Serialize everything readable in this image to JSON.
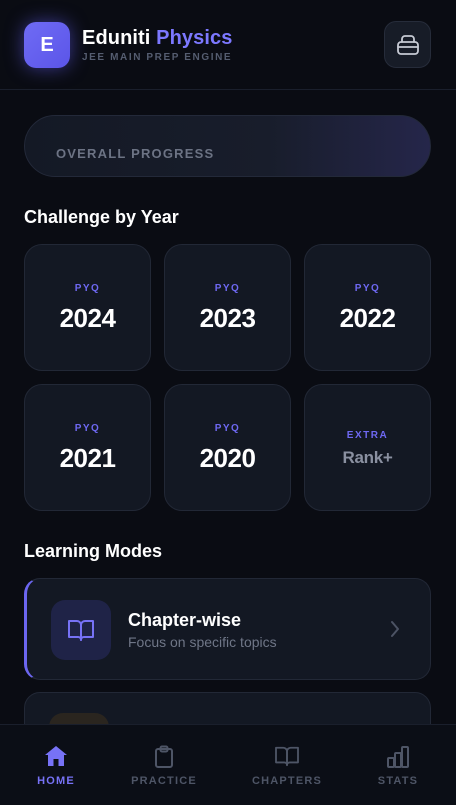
{
  "header": {
    "logo_letter": "E",
    "title_main": "Eduniti",
    "title_accent": "Physics",
    "subtitle": "JEE MAIN PREP ENGINE",
    "profile_icon": "briefcase-icon"
  },
  "progress": {
    "label": "OVERALL PROGRESS"
  },
  "years_section": {
    "title": "Challenge by Year",
    "cards": [
      {
        "tag": "PYQ",
        "value": "2024"
      },
      {
        "tag": "PYQ",
        "value": "2023"
      },
      {
        "tag": "PYQ",
        "value": "2022"
      },
      {
        "tag": "PYQ",
        "value": "2021"
      },
      {
        "tag": "PYQ",
        "value": "2020"
      },
      {
        "tag": "EXTRA",
        "value": "Rank+"
      }
    ]
  },
  "modes_section": {
    "title": "Learning Modes",
    "items": [
      {
        "title": "Chapter-wise",
        "description": "Focus on specific topics",
        "icon": "book-open-icon"
      }
    ]
  },
  "nav": {
    "items": [
      {
        "label": "HOME",
        "icon": "home-icon",
        "active": true
      },
      {
        "label": "PRACTICE",
        "icon": "clipboard-icon",
        "active": false
      },
      {
        "label": "CHAPTERS",
        "icon": "book-open-icon",
        "active": false
      },
      {
        "label": "STATS",
        "icon": "bar-chart-icon",
        "active": false
      }
    ]
  },
  "colors": {
    "accent": "#6c66f0",
    "background": "#0a0c13",
    "card": "#131823"
  }
}
